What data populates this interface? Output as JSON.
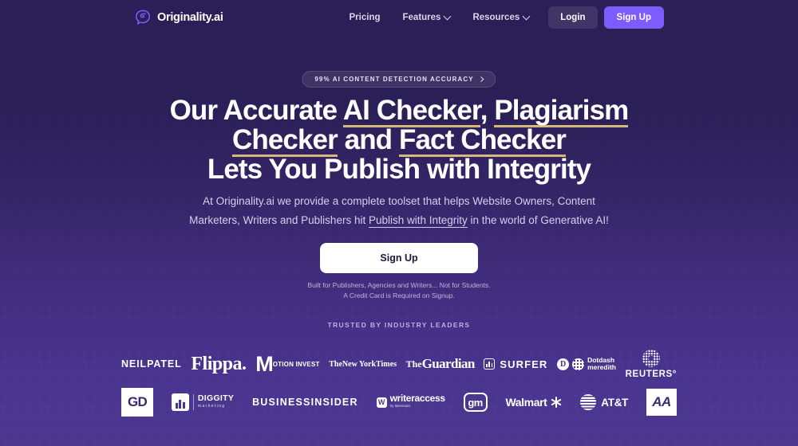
{
  "nav": {
    "brand": "Originality.ai",
    "brand_icon": "brain-swirl-icon",
    "links": [
      {
        "label": "Pricing",
        "has_caret": false
      },
      {
        "label": "Features",
        "has_caret": true
      },
      {
        "label": "Resources",
        "has_caret": true
      }
    ],
    "login_label": "Login",
    "signup_label": "Sign Up"
  },
  "hero": {
    "badge": "99% AI CONTENT DETECTION ACCURACY",
    "heading": {
      "line1_a": "Our Accurate ",
      "line1_b": "AI Checker",
      "line1_c": ", ",
      "line1_d": "Plagiarism",
      "line2_a": "Checker",
      "line2_b": " and ",
      "line2_c": "Fact Checker",
      "line3": "Lets You Publish with Integrity"
    },
    "subtitle": {
      "part1": "At Originality.ai we provide a complete toolset that helps Website Owners, Content Marketers, Writers and Publishers hit ",
      "link": "Publish with Integrity",
      "part2": " in the world of Generative AI!"
    },
    "cta_label": "Sign Up",
    "fineprint_line1": "Built for Publishers, Agencies and Writers... Not for Students.",
    "fineprint_line2": "A Credit Card is Required on Signup.",
    "trusted_label": "TRUSTED BY INDUSTRY LEADERS"
  },
  "logos": {
    "row1": [
      {
        "name": "neilpatel",
        "text": "NEILPATEL"
      },
      {
        "name": "flippa",
        "text": "Flippa."
      },
      {
        "name": "motion-invest",
        "text": "M",
        "text2": "otion invest"
      },
      {
        "name": "new-york-times",
        "text": "The",
        "text2": "New York",
        "text3": "Times"
      },
      {
        "name": "the-guardian",
        "text": "The",
        "text2": "Guardian"
      },
      {
        "name": "surfer",
        "text": "SURFER"
      },
      {
        "name": "dotdash-meredith",
        "text": "Dotdash",
        "text2": "meredith"
      },
      {
        "name": "reuters",
        "text": "REUTERS°"
      }
    ],
    "row2": [
      {
        "name": "gd",
        "text": "GD"
      },
      {
        "name": "diggity-marketing",
        "text": "DIGGITY",
        "text2": "marketing"
      },
      {
        "name": "business-insider",
        "text": "BUSINESS",
        "text2": "INSIDER"
      },
      {
        "name": "writeraccess",
        "text": "writeraccess",
        "text2": "by talentcast"
      },
      {
        "name": "gm",
        "text": "gm"
      },
      {
        "name": "walmart",
        "text": "Walmart"
      },
      {
        "name": "att",
        "text": "AT&T"
      },
      {
        "name": "american-airlines",
        "text": "AA"
      }
    ]
  },
  "colors": {
    "bg_top": "#2a1f56",
    "bg_bottom": "#4a3590",
    "accent_purple": "#7c5cfc",
    "underline_gold": "#d9b87c",
    "text_light": "#d5d0ea"
  }
}
